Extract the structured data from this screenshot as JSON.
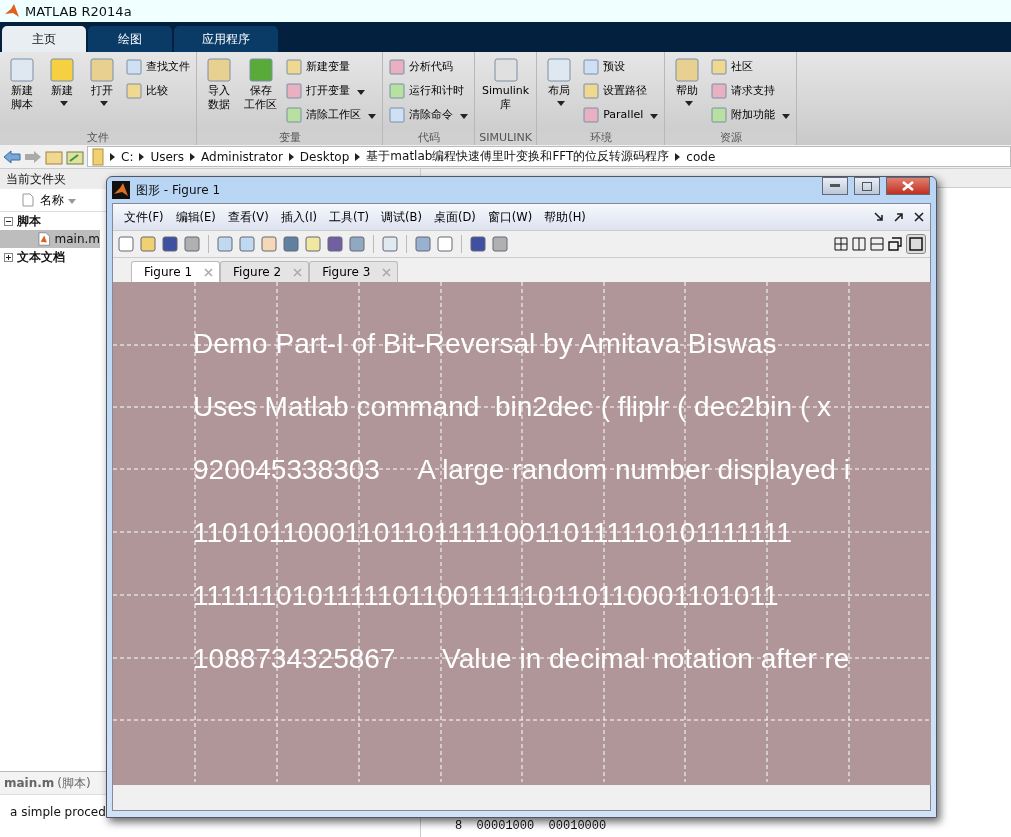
{
  "window": {
    "title": "MATLAB R2014a"
  },
  "ribbon_tabs": [
    {
      "label": "主页",
      "selected": true
    },
    {
      "label": "绘图",
      "selected": false
    },
    {
      "label": "应用程序",
      "selected": false
    }
  ],
  "ribbon_groups": [
    {
      "label": "文件",
      "large": [
        {
          "lines": [
            "新建",
            "脚本"
          ],
          "dropdown": false
        },
        {
          "lines": [
            "新建"
          ],
          "dropdown": true
        },
        {
          "lines": [
            "打开"
          ],
          "dropdown": true
        }
      ],
      "small": [
        {
          "label": "查找文件",
          "dropdown": false
        },
        {
          "label": "比较",
          "dropdown": false
        }
      ]
    },
    {
      "label": "变量",
      "large": [
        {
          "lines": [
            "导入",
            "数据"
          ],
          "dropdown": false
        },
        {
          "lines": [
            "保存",
            "工作区"
          ],
          "dropdown": false
        }
      ],
      "small": [
        {
          "label": "新建变量",
          "dropdown": false
        },
        {
          "label": "打开变量",
          "dropdown": true
        },
        {
          "label": "清除工作区",
          "dropdown": true
        }
      ]
    },
    {
      "label": "代码",
      "small": [
        {
          "label": "分析代码",
          "dropdown": false
        },
        {
          "label": "运行和计时",
          "dropdown": false
        },
        {
          "label": "清除命令",
          "dropdown": true
        }
      ]
    },
    {
      "label": "SIMULINK",
      "large": [
        {
          "lines": [
            "Simulink",
            "库"
          ],
          "dropdown": false
        }
      ]
    },
    {
      "label": "环境",
      "large": [
        {
          "lines": [
            "布局"
          ],
          "dropdown": true
        }
      ],
      "small": [
        {
          "label": "预设",
          "dropdown": false
        },
        {
          "label": "设置路径",
          "dropdown": false
        },
        {
          "label": "Parallel",
          "dropdown": true
        }
      ]
    },
    {
      "label": "资源",
      "large": [
        {
          "lines": [
            "帮助"
          ],
          "dropdown": true
        }
      ],
      "small": [
        {
          "label": "社区",
          "dropdown": false
        },
        {
          "label": "请求支持",
          "dropdown": false
        },
        {
          "label": "附加功能",
          "dropdown": true
        }
      ]
    }
  ],
  "path": [
    "C:",
    "Users",
    "Administrator",
    "Desktop",
    "基于matlab编程快速傅里叶变换和FFT的位反转源码程序",
    "code"
  ],
  "file_panel": {
    "title": "当前文件夹",
    "column": "名称",
    "tree": [
      {
        "label": "脚本",
        "expanded": true,
        "children": [
          {
            "label": "main.m",
            "selected": true
          }
        ]
      },
      {
        "label": "文本文档",
        "expanded": false
      }
    ],
    "details_name": "main.m",
    "details_type": "(脚本)",
    "description": "a simple proced"
  },
  "command_output": "8  00001000  00010000",
  "figure": {
    "title": "图形 - Figure 1",
    "menu": [
      "文件(F)",
      "编辑(E)",
      "查看(V)",
      "插入(I)",
      "工具(T)",
      "调试(B)",
      "桌面(D)",
      "窗口(W)",
      "帮助(H)"
    ],
    "tabs": [
      {
        "label": "Figure 1",
        "selected": true
      },
      {
        "label": "Figure 2",
        "selected": false
      },
      {
        "label": "Figure 3",
        "selected": false
      }
    ],
    "lines": [
      "Demo Part-I of Bit-Reversal by Amitava Biswas",
      "Uses Matlab command  bin2dec ( fliplr ( dec2bin ( x",
      "920045338303     A large random number displayed i",
      "11010110001101101111100110111110101111111",
      "1111110101111101100111110110110001101011",
      "1088734325867      Value in decimal notation after re"
    ]
  }
}
